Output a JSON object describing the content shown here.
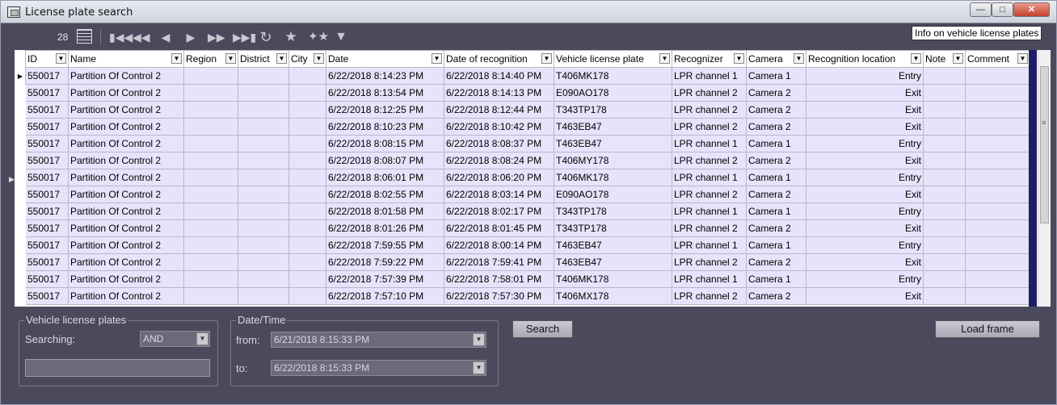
{
  "window": {
    "title": "License plate search"
  },
  "toolbar": {
    "count": "28",
    "icons": [
      "table-view-icon",
      "first-icon",
      "prev-page-icon",
      "prev-icon",
      "next-icon",
      "next-page-icon",
      "last-icon",
      "refresh-icon",
      "star-icon",
      "star-add-icon",
      "filter-icon"
    ]
  },
  "tooltip": "Info on vehicle license plates",
  "columns": [
    "ID",
    "Name",
    "Region",
    "District",
    "City",
    "Date",
    "Date of recognition",
    "Vehicle license plate",
    "Recognizer",
    "Camera",
    "Recognition location",
    "Note",
    "Comment"
  ],
  "rows": [
    [
      "550017",
      "Partition  Of Control 2",
      "",
      "",
      "",
      "6/22/2018 8:14:23 PM",
      "6/22/2018 8:14:40 PM",
      "T406MK178",
      "LPR channel 1",
      "Camera 1",
      "Entry",
      "",
      ""
    ],
    [
      "550017",
      "Partition  Of Control 2",
      "",
      "",
      "",
      "6/22/2018 8:13:54 PM",
      "6/22/2018 8:14:13 PM",
      "E090AO178",
      "LPR channel 2",
      "Camera 2",
      "Exit",
      "",
      ""
    ],
    [
      "550017",
      "Partition  Of Control 2",
      "",
      "",
      "",
      "6/22/2018 8:12:25 PM",
      "6/22/2018 8:12:44 PM",
      "T343TP178",
      "LPR channel 2",
      "Camera 2",
      "Exit",
      "",
      ""
    ],
    [
      "550017",
      "Partition  Of Control 2",
      "",
      "",
      "",
      "6/22/2018 8:10:23 PM",
      "6/22/2018 8:10:42 PM",
      "T463EB47",
      "LPR channel 2",
      "Camera 2",
      "Exit",
      "",
      ""
    ],
    [
      "550017",
      "Partition  Of Control 2",
      "",
      "",
      "",
      "6/22/2018 8:08:15 PM",
      "6/22/2018 8:08:37 PM",
      "T463EB47",
      "LPR channel 1",
      "Camera 1",
      "Entry",
      "",
      ""
    ],
    [
      "550017",
      "Partition  Of Control 2",
      "",
      "",
      "",
      "6/22/2018 8:08:07 PM",
      "6/22/2018 8:08:24 PM",
      "T406MY178",
      "LPR channel 2",
      "Camera 2",
      "Exit",
      "",
      ""
    ],
    [
      "550017",
      "Partition  Of Control 2",
      "",
      "",
      "",
      "6/22/2018 8:06:01 PM",
      "6/22/2018 8:06:20 PM",
      "T406MK178",
      "LPR channel 1",
      "Camera 1",
      "Entry",
      "",
      ""
    ],
    [
      "550017",
      "Partition  Of Control 2",
      "",
      "",
      "",
      "6/22/2018 8:02:55 PM",
      "6/22/2018 8:03:14 PM",
      "E090AO178",
      "LPR channel 2",
      "Camera 2",
      "Exit",
      "",
      ""
    ],
    [
      "550017",
      "Partition  Of Control 2",
      "",
      "",
      "",
      "6/22/2018 8:01:58 PM",
      "6/22/2018 8:02:17 PM",
      "T343TP178",
      "LPR channel 1",
      "Camera 1",
      "Entry",
      "",
      ""
    ],
    [
      "550017",
      "Partition  Of Control 2",
      "",
      "",
      "",
      "6/22/2018 8:01:26 PM",
      "6/22/2018 8:01:45 PM",
      "T343TP178",
      "LPR channel 2",
      "Camera 2",
      "Exit",
      "",
      ""
    ],
    [
      "550017",
      "Partition  Of Control 2",
      "",
      "",
      "",
      "6/22/2018 7:59:55 PM",
      "6/22/2018 8:00:14 PM",
      "T463EB47",
      "LPR channel 1",
      "Camera 1",
      "Entry",
      "",
      ""
    ],
    [
      "550017",
      "Partition  Of Control 2",
      "",
      "",
      "",
      "6/22/2018 7:59:22 PM",
      "6/22/2018 7:59:41 PM",
      "T463EB47",
      "LPR channel 2",
      "Camera 2",
      "Exit",
      "",
      ""
    ],
    [
      "550017",
      "Partition  Of Control 2",
      "",
      "",
      "",
      "6/22/2018 7:57:39 PM",
      "6/22/2018 7:58:01 PM",
      "T406MK178",
      "LPR channel 1",
      "Camera 1",
      "Entry",
      "",
      ""
    ],
    [
      "550017",
      "Partition  Of Control 2",
      "",
      "",
      "",
      "6/22/2018 7:57:10 PM",
      "6/22/2018 7:57:30 PM",
      "T406MX178",
      "LPR channel 2",
      "Camera 2",
      "Exit",
      "",
      ""
    ]
  ],
  "plates_group": {
    "title": "Vehicle license plates",
    "searching_label": "Searching:",
    "searching_value": "AND",
    "plate_input_value": ""
  },
  "datetime_group": {
    "title": "Date/Time",
    "from_label": "from:",
    "from_value": "6/21/2018 8:15:33 PM",
    "to_label": "to:",
    "to_value": "6/22/2018 8:15:33 PM"
  },
  "buttons": {
    "search": "Search",
    "load_frame": "Load frame"
  },
  "colors": {
    "background": "#4a4a5c",
    "row_fill": "#e6e4fa",
    "scroll_accent": "#1e1e66"
  }
}
